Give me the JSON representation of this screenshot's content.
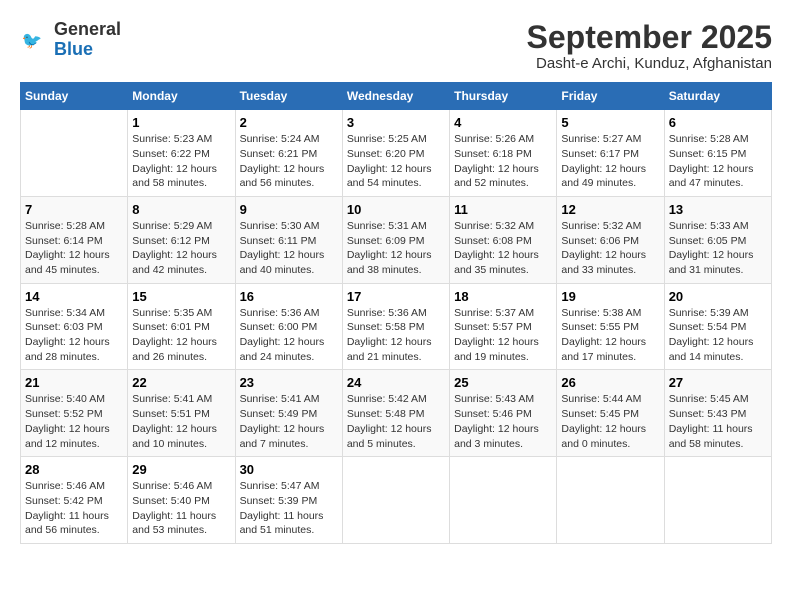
{
  "logo": {
    "line1": "General",
    "line2": "Blue"
  },
  "title": "September 2025",
  "subtitle": "Dasht-e Archi, Kunduz, Afghanistan",
  "days_of_week": [
    "Sunday",
    "Monday",
    "Tuesday",
    "Wednesday",
    "Thursday",
    "Friday",
    "Saturday"
  ],
  "weeks": [
    [
      {
        "num": "",
        "info": ""
      },
      {
        "num": "1",
        "info": "Sunrise: 5:23 AM\nSunset: 6:22 PM\nDaylight: 12 hours\nand 58 minutes."
      },
      {
        "num": "2",
        "info": "Sunrise: 5:24 AM\nSunset: 6:21 PM\nDaylight: 12 hours\nand 56 minutes."
      },
      {
        "num": "3",
        "info": "Sunrise: 5:25 AM\nSunset: 6:20 PM\nDaylight: 12 hours\nand 54 minutes."
      },
      {
        "num": "4",
        "info": "Sunrise: 5:26 AM\nSunset: 6:18 PM\nDaylight: 12 hours\nand 52 minutes."
      },
      {
        "num": "5",
        "info": "Sunrise: 5:27 AM\nSunset: 6:17 PM\nDaylight: 12 hours\nand 49 minutes."
      },
      {
        "num": "6",
        "info": "Sunrise: 5:28 AM\nSunset: 6:15 PM\nDaylight: 12 hours\nand 47 minutes."
      }
    ],
    [
      {
        "num": "7",
        "info": "Sunrise: 5:28 AM\nSunset: 6:14 PM\nDaylight: 12 hours\nand 45 minutes."
      },
      {
        "num": "8",
        "info": "Sunrise: 5:29 AM\nSunset: 6:12 PM\nDaylight: 12 hours\nand 42 minutes."
      },
      {
        "num": "9",
        "info": "Sunrise: 5:30 AM\nSunset: 6:11 PM\nDaylight: 12 hours\nand 40 minutes."
      },
      {
        "num": "10",
        "info": "Sunrise: 5:31 AM\nSunset: 6:09 PM\nDaylight: 12 hours\nand 38 minutes."
      },
      {
        "num": "11",
        "info": "Sunrise: 5:32 AM\nSunset: 6:08 PM\nDaylight: 12 hours\nand 35 minutes."
      },
      {
        "num": "12",
        "info": "Sunrise: 5:32 AM\nSunset: 6:06 PM\nDaylight: 12 hours\nand 33 minutes."
      },
      {
        "num": "13",
        "info": "Sunrise: 5:33 AM\nSunset: 6:05 PM\nDaylight: 12 hours\nand 31 minutes."
      }
    ],
    [
      {
        "num": "14",
        "info": "Sunrise: 5:34 AM\nSunset: 6:03 PM\nDaylight: 12 hours\nand 28 minutes."
      },
      {
        "num": "15",
        "info": "Sunrise: 5:35 AM\nSunset: 6:01 PM\nDaylight: 12 hours\nand 26 minutes."
      },
      {
        "num": "16",
        "info": "Sunrise: 5:36 AM\nSunset: 6:00 PM\nDaylight: 12 hours\nand 24 minutes."
      },
      {
        "num": "17",
        "info": "Sunrise: 5:36 AM\nSunset: 5:58 PM\nDaylight: 12 hours\nand 21 minutes."
      },
      {
        "num": "18",
        "info": "Sunrise: 5:37 AM\nSunset: 5:57 PM\nDaylight: 12 hours\nand 19 minutes."
      },
      {
        "num": "19",
        "info": "Sunrise: 5:38 AM\nSunset: 5:55 PM\nDaylight: 12 hours\nand 17 minutes."
      },
      {
        "num": "20",
        "info": "Sunrise: 5:39 AM\nSunset: 5:54 PM\nDaylight: 12 hours\nand 14 minutes."
      }
    ],
    [
      {
        "num": "21",
        "info": "Sunrise: 5:40 AM\nSunset: 5:52 PM\nDaylight: 12 hours\nand 12 minutes."
      },
      {
        "num": "22",
        "info": "Sunrise: 5:41 AM\nSunset: 5:51 PM\nDaylight: 12 hours\nand 10 minutes."
      },
      {
        "num": "23",
        "info": "Sunrise: 5:41 AM\nSunset: 5:49 PM\nDaylight: 12 hours\nand 7 minutes."
      },
      {
        "num": "24",
        "info": "Sunrise: 5:42 AM\nSunset: 5:48 PM\nDaylight: 12 hours\nand 5 minutes."
      },
      {
        "num": "25",
        "info": "Sunrise: 5:43 AM\nSunset: 5:46 PM\nDaylight: 12 hours\nand 3 minutes."
      },
      {
        "num": "26",
        "info": "Sunrise: 5:44 AM\nSunset: 5:45 PM\nDaylight: 12 hours\nand 0 minutes."
      },
      {
        "num": "27",
        "info": "Sunrise: 5:45 AM\nSunset: 5:43 PM\nDaylight: 11 hours\nand 58 minutes."
      }
    ],
    [
      {
        "num": "28",
        "info": "Sunrise: 5:46 AM\nSunset: 5:42 PM\nDaylight: 11 hours\nand 56 minutes."
      },
      {
        "num": "29",
        "info": "Sunrise: 5:46 AM\nSunset: 5:40 PM\nDaylight: 11 hours\nand 53 minutes."
      },
      {
        "num": "30",
        "info": "Sunrise: 5:47 AM\nSunset: 5:39 PM\nDaylight: 11 hours\nand 51 minutes."
      },
      {
        "num": "",
        "info": ""
      },
      {
        "num": "",
        "info": ""
      },
      {
        "num": "",
        "info": ""
      },
      {
        "num": "",
        "info": ""
      }
    ]
  ]
}
